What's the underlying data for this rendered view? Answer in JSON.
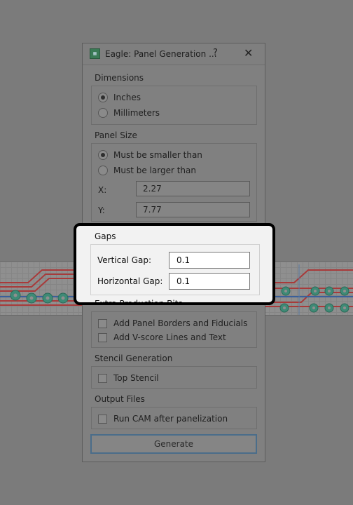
{
  "window": {
    "title": "Eagle: Panel Generation ...",
    "help_label": "?",
    "close_label": "✕",
    "icon": "board-icon"
  },
  "dimensions": {
    "title": "Dimensions",
    "options": [
      {
        "label": "Inches",
        "selected": true
      },
      {
        "label": "Millimeters",
        "selected": false
      }
    ]
  },
  "panel_size": {
    "title": "Panel Size",
    "options": [
      {
        "label": "Must be smaller than",
        "selected": true
      },
      {
        "label": "Must be larger than",
        "selected": false
      }
    ],
    "x_label": "X:",
    "x_value": "2.27",
    "y_label": "Y:",
    "y_value": "7.77"
  },
  "gaps": {
    "title": "Gaps",
    "vertical_label": "Vertical Gap:",
    "vertical_value": "0.1",
    "horizontal_label": "Horizontal Gap:",
    "horizontal_value": "0.1"
  },
  "extra_production": {
    "title": "Extra Production Bits",
    "options": [
      {
        "label": "Add Panel Borders and Fiducials",
        "checked": false
      },
      {
        "label": "Add V-score Lines and Text",
        "checked": false
      }
    ]
  },
  "stencil": {
    "title": "Stencil Generation",
    "options": [
      {
        "label": "Top Stencil",
        "checked": false
      }
    ]
  },
  "output_files": {
    "title": "Output Files",
    "options": [
      {
        "label": "Run CAM after panelization",
        "checked": false
      }
    ]
  },
  "generate_label": "Generate",
  "colors": {
    "overlay": "#7b7b7b",
    "highlight_border": "#000000",
    "highlight_bg": "#f2f2f2",
    "trace_red": "#a83a3a",
    "pad_green": "#3f8a76",
    "button_border": "#4a6d8a"
  }
}
